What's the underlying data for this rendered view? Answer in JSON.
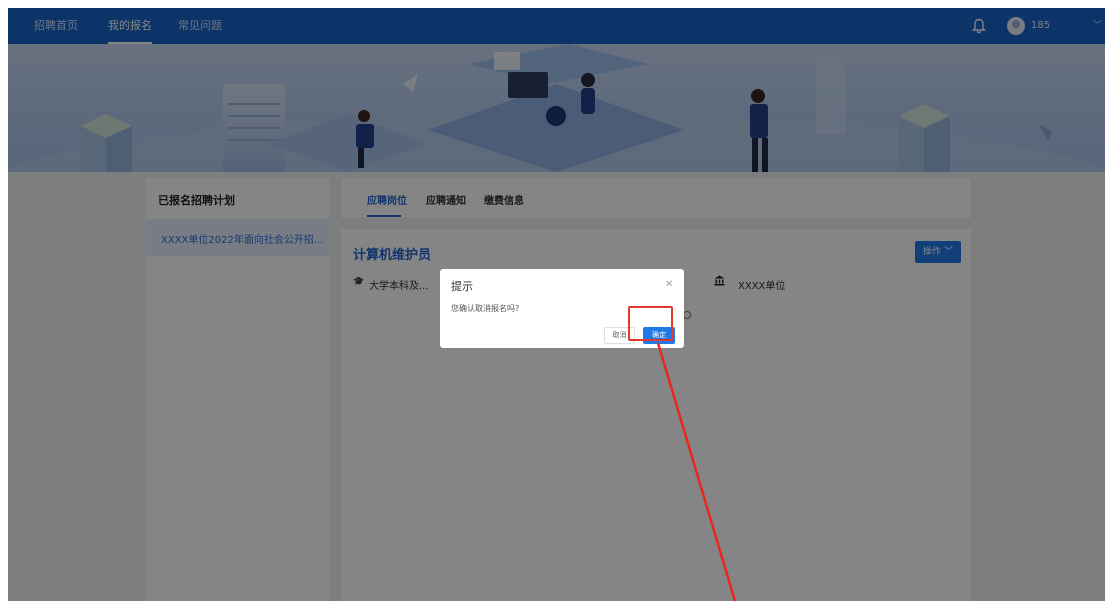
{
  "nav": {
    "items": [
      "招聘首页",
      "我的报名",
      "常见问题"
    ],
    "active_index": 1,
    "user_label": "185",
    "colors": {
      "bar": "#1765c8",
      "accent": "#1f7ae8"
    }
  },
  "sidebar": {
    "title": "已报名招聘计划",
    "items": [
      {
        "label": "XXXX单位2022年面向社会公开招..."
      }
    ]
  },
  "tabs": [
    "应聘岗位",
    "应聘通知",
    "缴费信息"
  ],
  "active_tab": 0,
  "job": {
    "title": "计算机维护员",
    "operation_label": "操作",
    "education": "大学本科及...",
    "unit": "XXXX单位"
  },
  "dialog": {
    "title": "提示",
    "message": "您确认取消报名吗?",
    "cancel_label": "取消",
    "confirm_label": "确定"
  },
  "icons": {
    "bell": "bell-icon",
    "avatar": "avatar-icon",
    "education": "graduation-cap-icon",
    "unit": "bank-icon",
    "close": "close-icon",
    "caret": "chevron-down-icon"
  },
  "annotation": {
    "color": "#e23a2a"
  }
}
